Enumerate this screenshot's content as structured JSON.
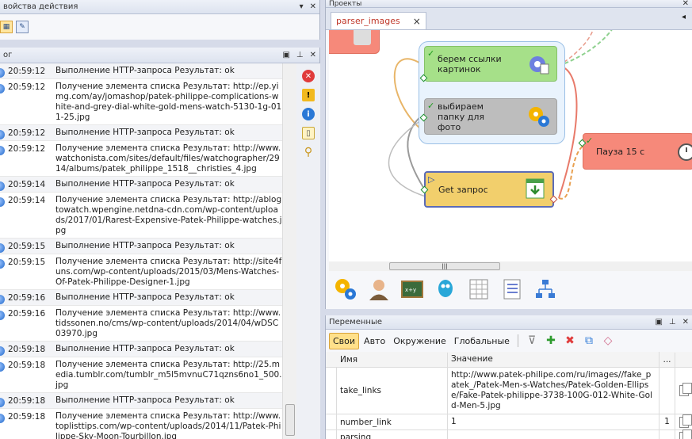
{
  "properties": {
    "title": "войства действия"
  },
  "log": {
    "title": "ог",
    "rows": [
      {
        "time": "20:59:12",
        "message": "Выполнение HTTP-запроса  Результат: ok"
      },
      {
        "time": "20:59:12",
        "message": "Получение элемента списка  Результат: http://ep.yimg.com/ay/jomashop/patek-philippe-complications-white-and-grey-dial-white-gold-mens-watch-5130-1g-011-25.jpg"
      },
      {
        "time": "20:59:12",
        "message": "Выполнение HTTP-запроса  Результат: ok"
      },
      {
        "time": "20:59:12",
        "message": "Получение элемента списка  Результат: http://www.watchonista.com/sites/default/files/watchographer/2914/albums/patek_philippe_1518__christies_4.jpg"
      },
      {
        "time": "20:59:14",
        "message": "Выполнение HTTP-запроса  Результат: ok"
      },
      {
        "time": "20:59:14",
        "message": "Получение элемента списка  Результат: http://ablogtowatch.wpengine.netdna-cdn.com/wp-content/uploads/2017/01/Rarest-Expensive-Patek-Philippe-watches.jpg"
      },
      {
        "time": "20:59:15",
        "message": "Выполнение HTTP-запроса  Результат: ok"
      },
      {
        "time": "20:59:15",
        "message": "Получение элемента списка  Результат: http://site4funs.com/wp-content/uploads/2015/03/Mens-Watches-Of-Patek-Philippe-Designer-1.jpg"
      },
      {
        "time": "20:59:16",
        "message": "Выполнение HTTP-запроса  Результат: ok"
      },
      {
        "time": "20:59:16",
        "message": "Получение элемента списка  Результат: http://www.tidssonen.no/cms/wp-content/uploads/2014/04/wDSC03970.jpg"
      },
      {
        "time": "20:59:18",
        "message": "Выполнение HTTP-запроса  Результат: ok"
      },
      {
        "time": "20:59:18",
        "message": "Получение элемента списка  Результат: http://25.media.tumblr.com/tumblr_m5l5mvnuC71qzns6no1_500.jpg"
      },
      {
        "time": "20:59:18",
        "message": "Выполнение HTTP-запроса  Результат: ok"
      },
      {
        "time": "20:59:18",
        "message": "Получение элемента списка  Результат: http://www.toplisttips.com/wp-content/uploads/2014/11/Patek-Philippe-Sky-Moon-Tourbillon.jpg"
      }
    ]
  },
  "projects": {
    "title": "Проекты",
    "tab_label": "parser_images",
    "tab_close": "×",
    "nodes": {
      "green": "берем ссылки картинок",
      "grey": "выбираем папку для фото",
      "get": "Get запрос",
      "pause": "Пауза 15 с"
    },
    "scroll_grip": "|||"
  },
  "variables": {
    "title": "Переменные",
    "tabs": [
      "Свои",
      "Авто",
      "Окружение",
      "Глобальные"
    ],
    "columns": {
      "name": "Имя",
      "value": "Значение",
      "dots": "..."
    },
    "rows": [
      {
        "name": "take_links",
        "value": "http://www.patek-philipe.com/ru/images//fake_patek_/Patek-Men-s-Watches/Patek-Golden-Ellipse/Fake-Patek-philippe-3738-100G-012-White-Gold-Men-5.jpg",
        "extra": ""
      },
      {
        "name": "number_link",
        "value": "1",
        "extra": "1"
      },
      {
        "name": "parsing",
        "value": "",
        "extra": ""
      }
    ]
  },
  "colors": {
    "accent_tab": "#c0392b",
    "node_green": "#a6e089",
    "node_grey": "#bdbdbd",
    "node_get": "#f2cf6c",
    "node_pause": "#f6897a"
  }
}
